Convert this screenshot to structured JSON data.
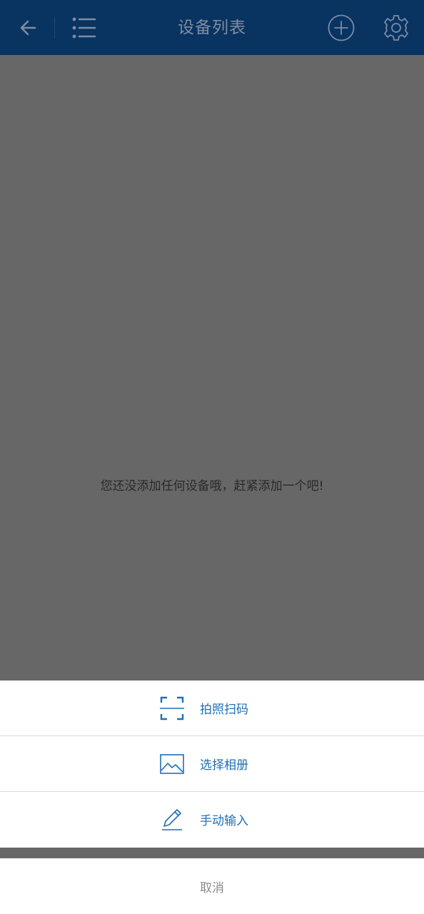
{
  "header": {
    "title": "设备列表",
    "icons": {
      "back": "arrow-left-icon",
      "list": "list-icon",
      "add": "plus-circle-icon",
      "settings": "gear-icon"
    }
  },
  "main": {
    "empty_message": "您还没添加任何设备哦，赶紧添加一个吧!"
  },
  "action_sheet": {
    "items": [
      {
        "label": "拍照扫码",
        "icon": "scan-icon"
      },
      {
        "label": "选择相册",
        "icon": "image-icon"
      },
      {
        "label": "手动输入",
        "icon": "pencil-icon"
      }
    ],
    "cancel_label": "取消"
  },
  "colors": {
    "header_bg": "#093361",
    "overlay": "#676767",
    "accent": "#1f6fb5"
  }
}
